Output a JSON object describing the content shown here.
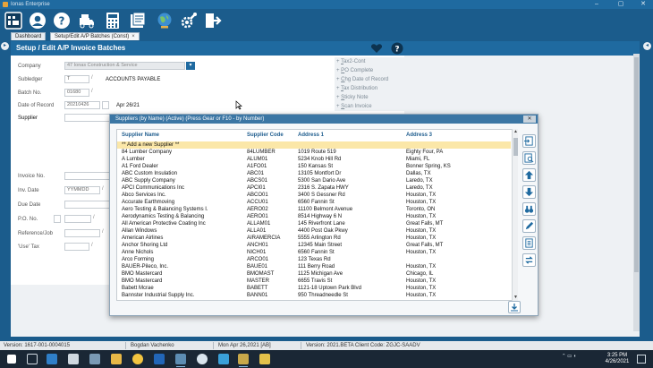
{
  "window": {
    "title": "Ionas Enterprise",
    "controls": [
      "–",
      "▢",
      "✕"
    ]
  },
  "toolbar": {
    "buttons": [
      {
        "name": "dashboard-icon"
      },
      {
        "name": "user-icon"
      },
      {
        "name": "help-icon"
      },
      {
        "name": "truck-icon"
      },
      {
        "name": "calculator-icon"
      },
      {
        "name": "report-icon"
      },
      {
        "name": "globe-icon"
      },
      {
        "name": "settings-wrench-icon"
      },
      {
        "name": "exit-icon"
      }
    ]
  },
  "tabs": [
    {
      "label": "Dashboard",
      "active": false
    },
    {
      "label": "Setup/Edit A/P Batches (Const)",
      "close": "×",
      "active": true
    }
  ],
  "panel": {
    "title": "Setup / Edit A/P Invoice Batches"
  },
  "form": {
    "company_label": "Company",
    "company_value": "47 Ionas Construction & Service",
    "subledger_label": "Subledger",
    "subledger_value": "T",
    "subledger_desc": "ACCOUNTS PAYABLE",
    "batch_label": "Batch No.",
    "batch_value": "01680",
    "date_label": "Date of Record",
    "date_value": "20210426",
    "date_desc": "Apr 26/21",
    "supplier_label": "Supplier",
    "invoice_label": "Invoice No.",
    "invdate_label": "Inv. Date",
    "invdate_placeholder": "YYMMDD",
    "duedate_label": "Due Date",
    "po_label": "P.O. No.",
    "reference_label": "Reference/Job",
    "usetax_label": "'Use' Tax"
  },
  "sidelinks": [
    {
      "prefix": "+ ",
      "u": "T",
      "rest": "ax2-Cont"
    },
    {
      "prefix": "+ ",
      "u": "P",
      "rest": "O Complete"
    },
    {
      "prefix": "+ ",
      "u": "C",
      "rest": "hg Date of Record"
    },
    {
      "prefix": "+ ",
      "u": "T",
      "rest": "ax Distribution"
    },
    {
      "prefix": "+ ",
      "u": "S",
      "rest": "ticky Note"
    },
    {
      "prefix": "+ ",
      "u": "S",
      "rest": "can Invoice"
    }
  ],
  "popup": {
    "title": "Suppliers (by Name)  (Active) (Press Gear or F10 - by Number)",
    "close": "✕",
    "columns": [
      "Supplier Name",
      "Supplier Code",
      "Address 1",
      "Address 3"
    ],
    "rows": [
      [
        "** Add a new Supplier **",
        "",
        "",
        ""
      ],
      [
        "84 Lumber Company",
        "84LUMBER",
        "1019 Route 519",
        "Eighty Four, PA"
      ],
      [
        "A Lumber",
        "ALUM01",
        "5234 Knob Hill Rd",
        "Miami, FL"
      ],
      [
        "A1 Ford Dealer",
        "A1FO01",
        "150 Kansas St",
        "Bonner Spring, KS"
      ],
      [
        "ABC Custom Insulation",
        "ABC01",
        "13105 Montfort Dr",
        "Dallas, TX"
      ],
      [
        "ABC Supply Company",
        "ABCS01",
        "5300 San Dario Ave",
        "Laredo, TX"
      ],
      [
        "APCI Communications Inc",
        "APCI01",
        "2316 S. Zapata HWY",
        "Laredo, TX"
      ],
      [
        "Abco Services Inc.",
        "ABCO01",
        "3400 S Gessner Rd",
        "Houston, TX"
      ],
      [
        "Accurate Earthmoving",
        "ACCU01",
        "6560 Fannin St",
        "Houston, TX"
      ],
      [
        "Aero Testing & Balancing Systems I.",
        "AERO02",
        "11100 Belmont Avenue",
        "Toronto, ON"
      ],
      [
        "Aerodynamics Testing & Balancing",
        "AERO01",
        "8514 Highway 6 N",
        "Houston, TX"
      ],
      [
        "All American Protective Coating Inc",
        "ALLAM01",
        "145 Riverfront Lane",
        "Great Falls, MT"
      ],
      [
        "Allan Windows",
        "ALLA01",
        "4400 Post Oak Pkwy",
        "Houston, TX"
      ],
      [
        "American Airlines",
        "AIRAMERCIA",
        "5555 Arlington Rd",
        "Houston, TX"
      ],
      [
        "Anchor Shoring Ltd",
        "ANCH01",
        "12345 Main Street",
        "Great Falls, MT"
      ],
      [
        "Anne Nichols",
        "NICH01",
        "6560 Fannin St",
        "Houston, TX"
      ],
      [
        "Arco Forming",
        "ARCO01",
        "123 Texas Rd",
        ""
      ],
      [
        "BAUER-Pileco, Inc.",
        "BAUE01",
        "111 Berry Road",
        "Houston, TX"
      ],
      [
        "BMO Mastercard",
        "BMOMAST",
        "1125 Michigan Ave",
        "Chicago, IL"
      ],
      [
        "BMO Mastercard",
        "MASTER",
        "6655 Travis St",
        "Houston, TX"
      ],
      [
        "Babett Mcrae",
        "BABETT",
        "1121-18 Uptown Park Blvd",
        "Houston, TX"
      ],
      [
        "Bannster Industrial Supply Inc.",
        "BANN01",
        "950 Threadneedle St",
        "Houston, TX"
      ]
    ],
    "side_buttons": [
      {
        "name": "select-record-icon"
      },
      {
        "name": "search-record-icon"
      },
      {
        "name": "arrow-up-icon"
      },
      {
        "name": "arrow-down-icon"
      },
      {
        "name": "binoculars-icon"
      },
      {
        "name": "edit-pen-icon"
      },
      {
        "name": "document-list-icon"
      },
      {
        "name": "refresh-icon"
      }
    ]
  },
  "statusbar": {
    "version": "Version: 1617-001-0004015",
    "user": "Bogdan Vachenko",
    "date": "Mon Apr 26,2021 [AB]",
    "build": "Version: 2021.BETA  Client Code: ZGJC-SAADV"
  },
  "taskbar": {
    "time": "3:25 PM",
    "date": "4/26/2021",
    "colors": {
      "bg": "#1a2735",
      "accent": "#1f6aa0",
      "highlight_row": "#fbe7a8"
    }
  }
}
